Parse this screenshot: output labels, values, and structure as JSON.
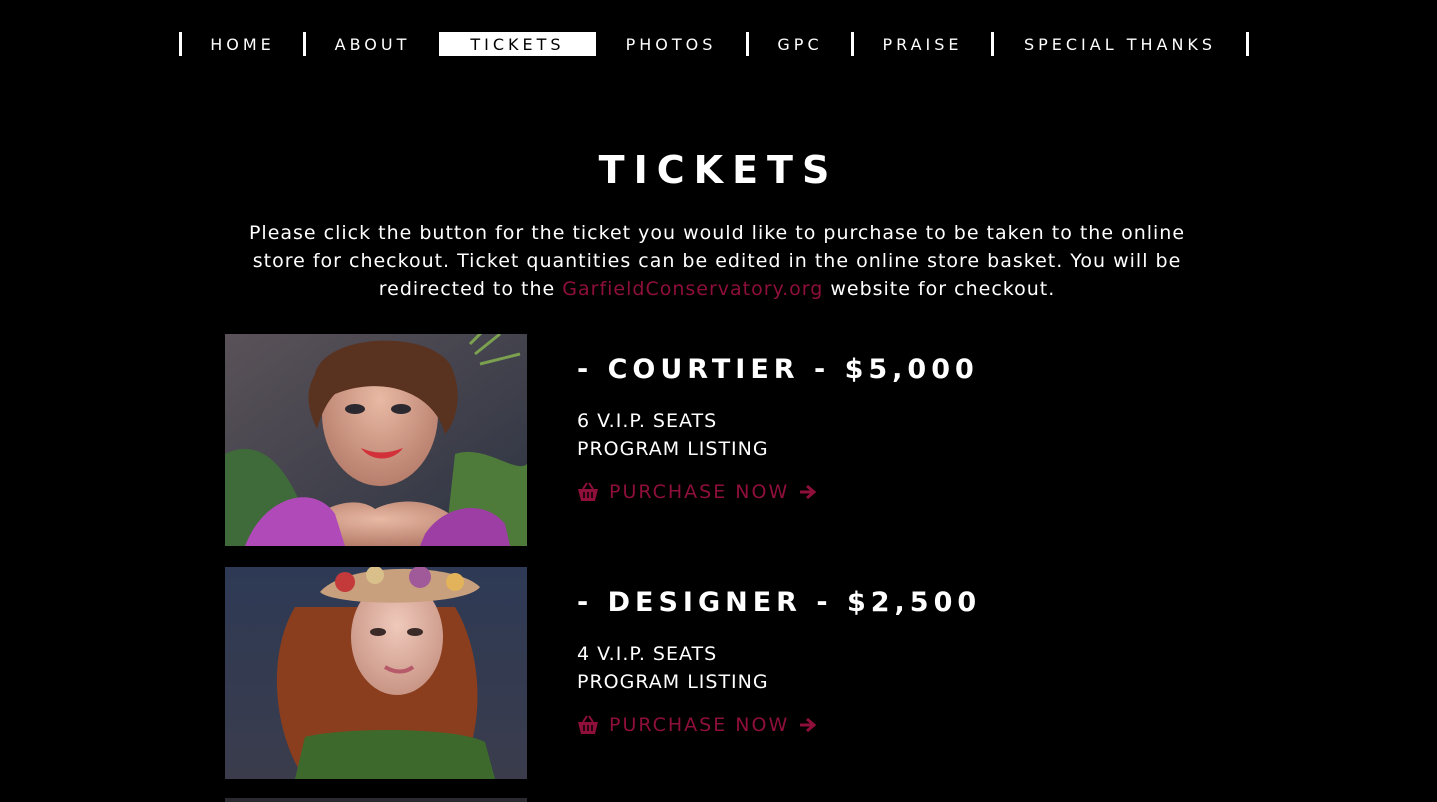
{
  "nav": {
    "items": [
      {
        "label": "HOME",
        "active": false
      },
      {
        "label": "ABOUT",
        "active": false
      },
      {
        "label": "TICKETS",
        "active": true
      },
      {
        "label": "PHOTOS",
        "active": false
      },
      {
        "label": "GPC",
        "active": false
      },
      {
        "label": "PRAISE",
        "active": false
      },
      {
        "label": "SPECIAL THANKS",
        "active": false
      }
    ]
  },
  "page": {
    "title": "TICKETS",
    "intro_before": "Please click the button for the ticket you would like to purchase to be taken to the online store for checkout. Ticket quantities can be edited in the online store basket. You will be redirected to the ",
    "intro_link": "GarfieldConservatory.org",
    "intro_after": " website for checkout."
  },
  "tickets": [
    {
      "name": "- COURTIER - $5,000",
      "perks": [
        "6 V.I.P. SEATS",
        "PROGRAM LISTING"
      ],
      "button": "PURCHASE NOW",
      "button_icon": "basket-icon",
      "arrow_icon": "arrow-right-icon"
    },
    {
      "name": "- DESIGNER - $2,500",
      "perks": [
        "4 V.I.P. SEATS",
        "PROGRAM LISTING"
      ],
      "button": "PURCHASE NOW",
      "button_icon": "basket-icon",
      "arrow_icon": "arrow-right-icon"
    }
  ],
  "colors": {
    "background": "#000000",
    "text": "#ffffff",
    "accent": "#8e0f3a"
  }
}
